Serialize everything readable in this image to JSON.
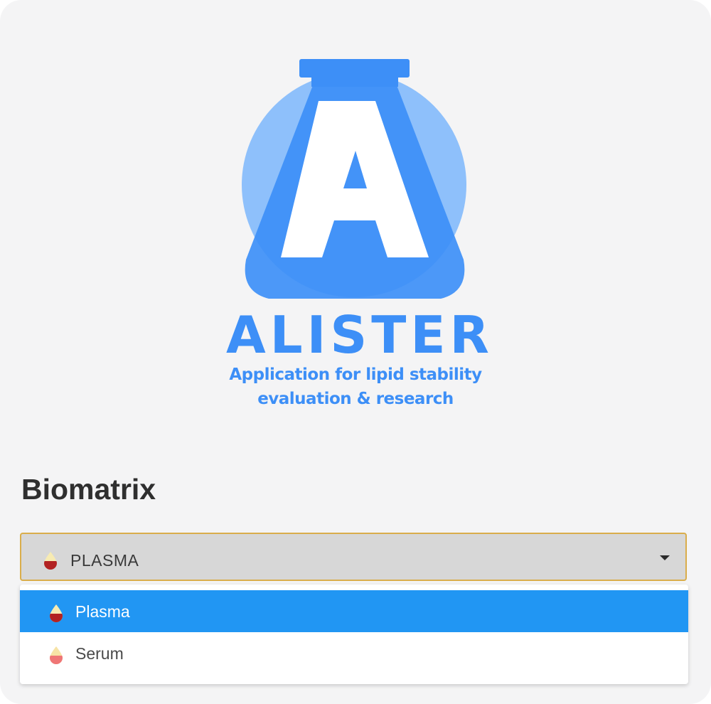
{
  "logo": {
    "name": "ALISTER",
    "tagline_line1": "Application for lipid stability",
    "tagline_line2": "evaluation & research",
    "icon": "flask-letter-a-icon",
    "colors": {
      "primary": "#3d8ff7",
      "circle": "#8ec0fb",
      "overlap": "#4a96f8"
    }
  },
  "biomatrix": {
    "title": "Biomatrix",
    "selected_value": "PLASMA",
    "selected_icon": "plasma-drop-icon",
    "caret_icon": "caret-down-icon",
    "options": [
      {
        "label": "Plasma",
        "icon": "plasma-drop-icon",
        "selected": true
      },
      {
        "label": "Serum",
        "icon": "serum-drop-icon",
        "selected": false
      }
    ],
    "colors": {
      "focus_border": "#d9ad4b",
      "select_bg": "#d7d7d7",
      "highlight": "#2196f3"
    }
  }
}
